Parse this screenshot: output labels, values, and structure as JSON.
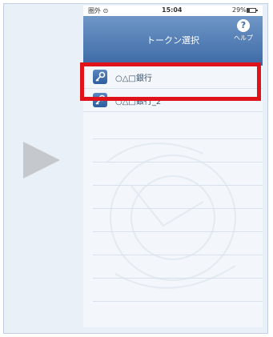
{
  "statusbar": {
    "carrier": "圏外 ⊙",
    "time": "15:04",
    "battery": "29%"
  },
  "navbar": {
    "title": "トークン選択",
    "help_label": "ヘルプ",
    "help_icon": "?"
  },
  "tokens": [
    {
      "label": "○△□銀行",
      "icon": "key-icon"
    },
    {
      "label": "○△□銀行_2",
      "icon": "key-icon"
    }
  ],
  "colors": {
    "nav_top": "#6f96c6",
    "nav_bottom": "#3d6aa6",
    "highlight": "#e0131b",
    "frame_bg": "#e9f0f8",
    "arrow": "#c5c9cd"
  }
}
